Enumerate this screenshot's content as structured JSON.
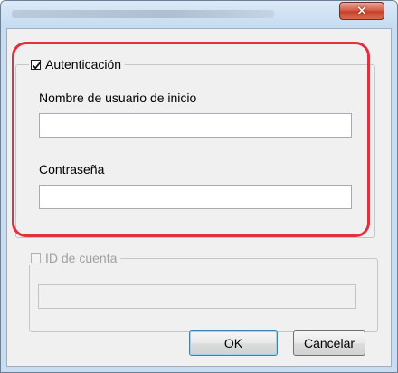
{
  "window": {
    "close_glyph": "✕"
  },
  "auth_group": {
    "checkbox_label": "Autenticación",
    "checked": true,
    "username_label": "Nombre de usuario de inicio",
    "username_value": "",
    "password_label": "Contraseña",
    "password_value": ""
  },
  "account_group": {
    "checkbox_label": "ID de cuenta",
    "checked": false,
    "enabled": false,
    "account_value": ""
  },
  "buttons": {
    "ok_label": "OK",
    "cancel_label": "Cancelar"
  },
  "colors": {
    "highlight": "#e2303f",
    "dialog_background": "#f0f0f0",
    "titlebar": "#c9ddf2"
  },
  "icons": {
    "close": "close-icon",
    "check": "check-icon"
  }
}
